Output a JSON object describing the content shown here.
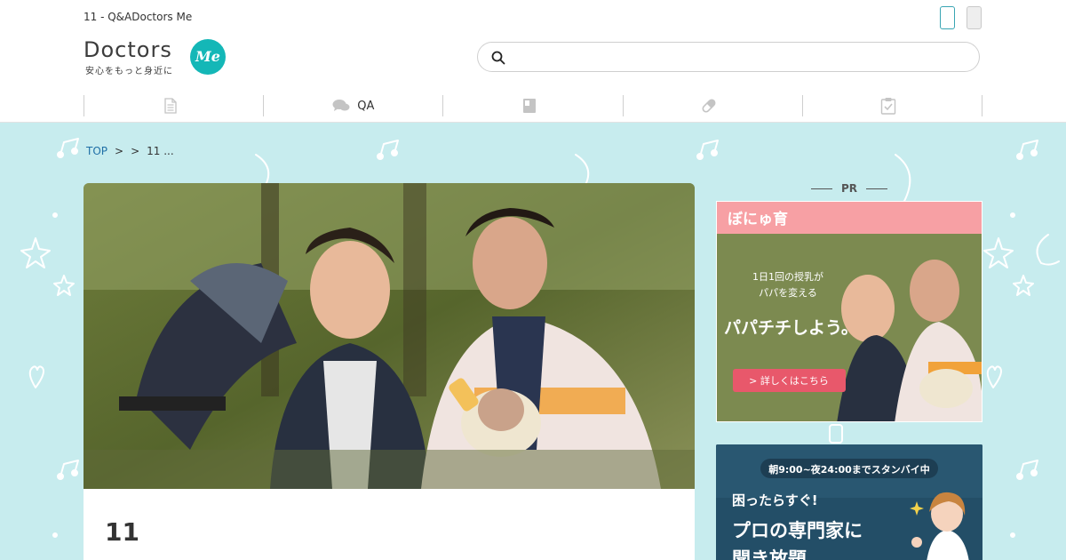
{
  "header": {
    "site_title": "11  - Q&ADoctors Me",
    "logo_text": "Doctors",
    "logo_badge": "Me",
    "logo_tagline": "安心をもっと身近に",
    "search_placeholder": ""
  },
  "nav": {
    "items": [
      {
        "label": "",
        "icon": "document-icon"
      },
      {
        "label": "QA",
        "icon": "chat-bubbles-icon"
      },
      {
        "label": "",
        "icon": "book-icon"
      },
      {
        "label": "",
        "icon": "pill-icon"
      },
      {
        "label": "",
        "icon": "clipboard-check-icon"
      }
    ]
  },
  "breadcrumb": {
    "top": "TOP",
    "sep1": ">",
    "sep2": ">",
    "current": "11 ..."
  },
  "article": {
    "title": "11"
  },
  "sidebar": {
    "pr_label": "PR",
    "ad1": {
      "brand": "ぼにゅ育",
      "line1": "1日1回の授乳が",
      "line2": "パパを変える",
      "headline": "パパチチしよう。",
      "cta": "> 詳しくはこちら"
    },
    "ad2": {
      "hours": "朝9:00~夜24:00までスタンバイ中",
      "line1": "困ったらすぐ!",
      "line2": "プロの専門家に",
      "line3": "聞き放題"
    }
  },
  "colors": {
    "background": "#c7ecee",
    "accent": "#14b7b7",
    "ad_banner": "#f7a0a4",
    "ad_button": "#e8586b",
    "ad2_bg": "#234e67"
  }
}
